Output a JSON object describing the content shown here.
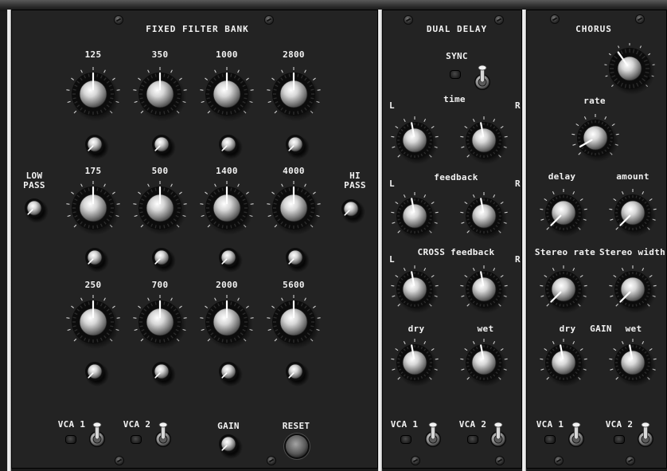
{
  "filter_bank": {
    "title": "FIXED FILTER BANK",
    "bands": [
      "125",
      "350",
      "1000",
      "2800",
      "175",
      "500",
      "1400",
      "4000",
      "250",
      "700",
      "2000",
      "5600"
    ],
    "low_pass": [
      "LOW",
      "PASS"
    ],
    "hi_pass": [
      "HI",
      "PASS"
    ],
    "vca1": "VCA 1",
    "vca2": "VCA 2",
    "gain": "GAIN",
    "reset": "RESET"
  },
  "delay": {
    "title": "DUAL DELAY",
    "sync": "SYNC",
    "time": "time",
    "feedback": "feedback",
    "cross_feedback": "CROSS feedback",
    "dry": "dry",
    "wet": "wet",
    "left": "L",
    "right": "R",
    "vca1": "VCA 1",
    "vca2": "VCA 2"
  },
  "chorus": {
    "title": "CHORUS",
    "rate": "rate",
    "delay": "delay",
    "amount": "amount",
    "stereo_rate": "Stereo rate",
    "stereo_width": "Stereo width",
    "dry": "dry",
    "gain": "GAIN",
    "wet": "wet",
    "vca1": "VCA 1",
    "vca2": "VCA 2"
  },
  "colors": {
    "panel": "#232323",
    "text": "#f2f2f2",
    "divider": "#ffffff",
    "screen_bg": "#1b1b1b"
  }
}
